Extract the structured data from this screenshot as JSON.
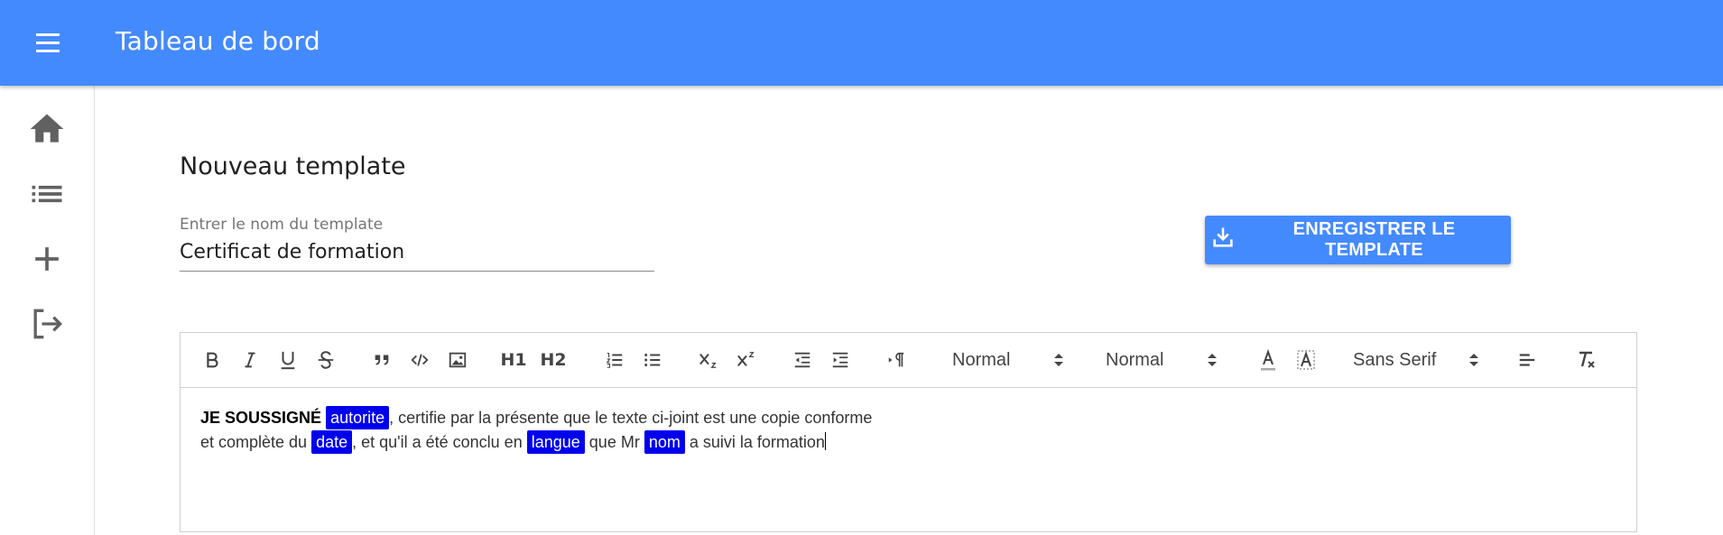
{
  "appbar": {
    "title": "Tableau de bord",
    "color": "#448aff"
  },
  "sidenav": {
    "items": [
      {
        "name": "home",
        "icon": "home-icon"
      },
      {
        "name": "list",
        "icon": "list-icon"
      },
      {
        "name": "add",
        "icon": "plus-icon"
      },
      {
        "name": "logout",
        "icon": "logout-icon"
      }
    ]
  },
  "main": {
    "title": "Nouveau template",
    "name_field": {
      "label": "Entrer le nom du template",
      "value": "Certificat de formation"
    },
    "save_button": {
      "label": "ENREGISTRER LE TEMPLATE",
      "icon": "download-icon"
    }
  },
  "editor": {
    "toolbar": {
      "header1": "H1",
      "header2": "H2",
      "size_value": "Normal",
      "header_value": "Normal",
      "font_value": "Sans Serif"
    },
    "content": {
      "line1_bold": "JE SOUSSIGNÉ",
      "tag_autorite": "autorite",
      "line1_rest": ", certifie par la présente que le texte ci-joint est une copie conforme",
      "line2_start": "et complète du",
      "tag_date": "date",
      "line2_mid1": ", et qu'il a été conclu en",
      "tag_langue": "langue",
      "line2_mid2": "que Mr",
      "tag_nom": "nom",
      "line2_end": "a suivi la formation"
    },
    "tag_color": "#0000ee"
  }
}
